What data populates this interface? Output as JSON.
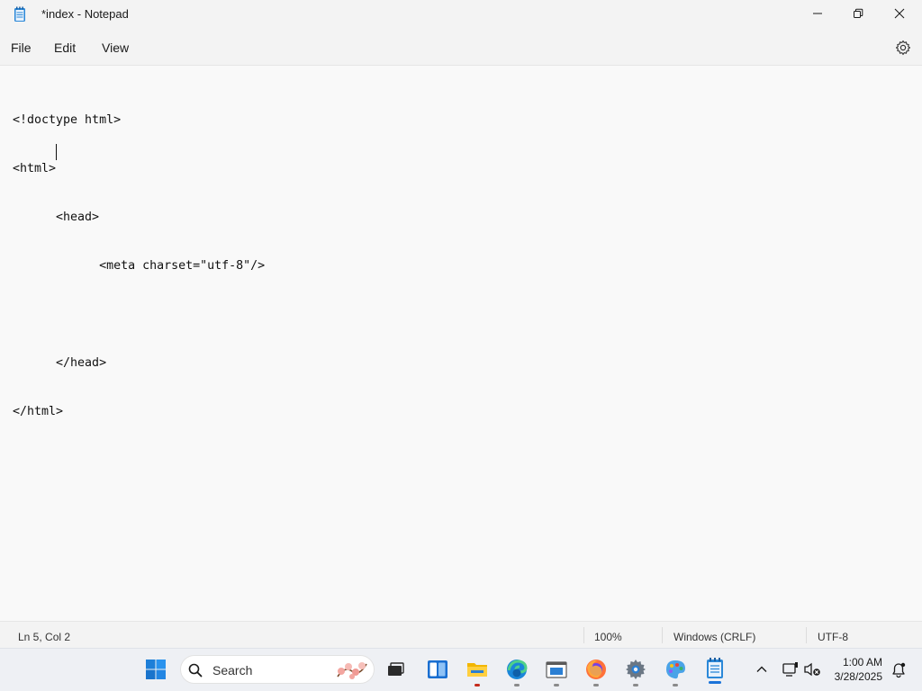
{
  "window": {
    "title": "*index - Notepad",
    "app_icon": "notepad-icon",
    "controls": [
      "minimize-icon",
      "restore-icon",
      "close-icon"
    ]
  },
  "menu": {
    "items": [
      "File",
      "Edit",
      "View"
    ],
    "settings_icon": "gear-icon"
  },
  "editor": {
    "lines": [
      "<!doctype html>",
      "<html>",
      "      <head>",
      "            <meta charset=\"utf-8\"/>",
      "      ",
      "      </head>",
      "</html>"
    ]
  },
  "status": {
    "position": "Ln 5, Col 2",
    "zoom": "100%",
    "line_ending": "Windows (CRLF)",
    "encoding": "UTF-8"
  },
  "taskbar": {
    "search_placeholder": "Search",
    "apps": [
      "windows-start-icon",
      "search-icon",
      "task-view-icon",
      "widgets-icon",
      "file-explorer-icon",
      "edge-icon",
      "store-window-icon",
      "firefox-icon",
      "settings-icon",
      "paint-icon",
      "notepad-icon"
    ],
    "tray": [
      "chevron-up-icon",
      "network-icon",
      "volume-muted-icon",
      "notification-icon"
    ],
    "time": "1:00 AM",
    "date": "3/28/2025"
  }
}
